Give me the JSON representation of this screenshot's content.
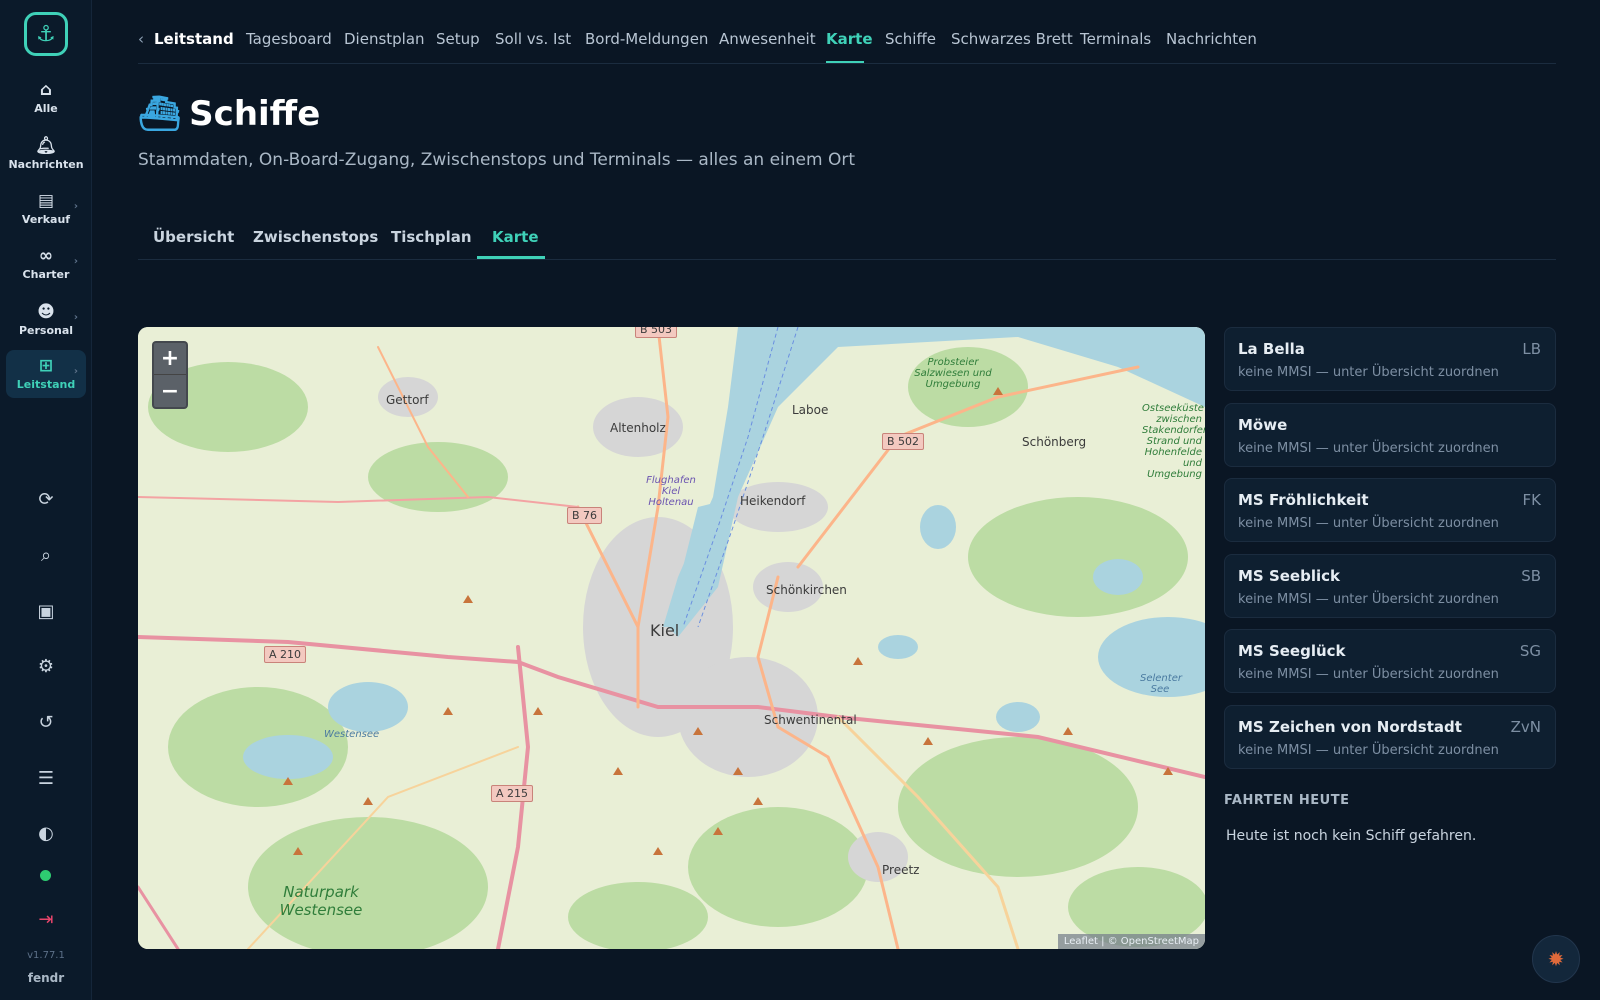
{
  "sidebar": {
    "logo_icon": "anchor-plus-logo",
    "items": [
      {
        "label": "Alle",
        "icon": "home-icon"
      },
      {
        "label": "Nachrichten",
        "icon": "bell-icon"
      },
      {
        "label": "Verkauf",
        "icon": "cash-register-icon"
      },
      {
        "label": "Charter",
        "icon": "binoculars-icon"
      },
      {
        "label": "Personal",
        "icon": "users-icon"
      },
      {
        "label": "Leitstand",
        "icon": "grid-icon"
      }
    ],
    "version": "v1.77.1",
    "brand": "fendr"
  },
  "topnav": {
    "crumb": "Leitstand",
    "links": [
      "Tagesboard",
      "Dienstplan",
      "Setup",
      "Soll vs. Ist",
      "Bord-Meldungen",
      "Anwesenheit",
      "Karte",
      "Schiffe",
      "Schwarzes Brett",
      "Terminals",
      "Nachrichten"
    ],
    "active": "Karte"
  },
  "page": {
    "title": "Schiffe",
    "subtitle": "Stammdaten, On-Board-Zugang, Zwischenstops und Terminals — alles an einem Ort"
  },
  "tabs": {
    "items": [
      "Übersicht",
      "Zwischenstops",
      "Tischplan",
      "Karte"
    ],
    "active": "Karte"
  },
  "map": {
    "zoom_in": "+",
    "zoom_out": "−",
    "attribution": "Leaflet | © OpenStreetMap",
    "places": [
      "Gettorf",
      "Altenholz",
      "Laboe",
      "Schönberg",
      "Heikendorf",
      "Schönkirchen",
      "Kiel",
      "Schwentinental",
      "Preetz",
      "Flughafen Kiel Holtenau",
      "Westensee",
      "Selenter See"
    ],
    "roads": [
      "B 503",
      "B 502",
      "B 76",
      "A 210",
      "A 215"
    ],
    "green_areas": [
      "Probsteier Salzwiesen und Umgebung",
      "Ostseeküste zwischen Stakendorfer Strand und Hohenfelde und Umgebung",
      "Naturpark Westensee"
    ]
  },
  "ships": [
    {
      "name": "La Bella",
      "abbr": "LB",
      "hint": "keine MMSI — unter Übersicht zuordnen"
    },
    {
      "name": "Möwe",
      "abbr": "",
      "hint": "keine MMSI — unter Übersicht zuordnen"
    },
    {
      "name": "MS Fröhlichkeit",
      "abbr": "FK",
      "hint": "keine MMSI — unter Übersicht zuordnen"
    },
    {
      "name": "MS Seeblick",
      "abbr": "SB",
      "hint": "keine MMSI — unter Übersicht zuordnen"
    },
    {
      "name": "MS Seeglück",
      "abbr": "SG",
      "hint": "keine MMSI — unter Übersicht zuordnen"
    },
    {
      "name": "MS Zeichen von Nordstadt",
      "abbr": "ZvN",
      "hint": "keine MMSI — unter Übersicht zuordnen"
    }
  ],
  "trips": {
    "heading": "FAHRTEN HEUTE",
    "empty": "Heute ist noch kein Schiff gefahren."
  },
  "colors": {
    "accent": "#3fd1b8",
    "background": "#0a1624"
  }
}
